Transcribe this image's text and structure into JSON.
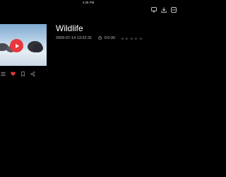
{
  "status_bar": {
    "time": "4:38 PM"
  },
  "toolbar": {
    "icons": [
      "cast-icon",
      "download-icon",
      "more-icon"
    ]
  },
  "item": {
    "thumbnail_description_icon": "play-icon",
    "title": "Wildlife",
    "date": "2009-07-14 13:32:31",
    "duration": "0:0:30",
    "rating": 0,
    "rating_max": 5
  },
  "actions": [
    "list-icon",
    "heart-icon",
    "bookmark-icon",
    "share-icon"
  ],
  "colors": {
    "accent": "#e8383d",
    "background": "#000000",
    "favorite": "#e8383d"
  }
}
